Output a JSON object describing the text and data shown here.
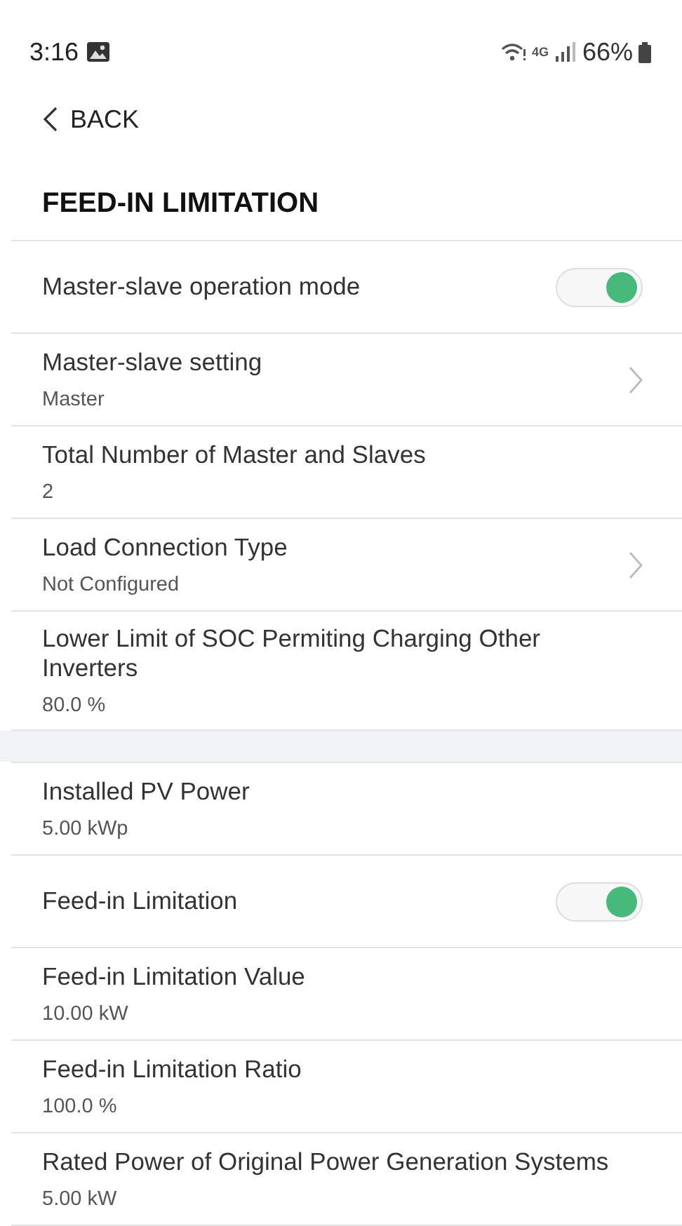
{
  "status_bar": {
    "time": "3:16",
    "network": "4G",
    "battery": "66%"
  },
  "back": {
    "label": "BACK"
  },
  "title": "FEED-IN LIMITATION",
  "sections": [
    {
      "items": [
        {
          "kind": "toggle",
          "label": "Master-slave operation mode",
          "on": true
        },
        {
          "kind": "nav",
          "label": "Master-slave setting",
          "value": "Master"
        },
        {
          "kind": "value",
          "label": "Total Number of Master and Slaves",
          "value": "2"
        },
        {
          "kind": "nav",
          "label": "Load Connection Type",
          "value": "Not Configured"
        },
        {
          "kind": "value",
          "label": "Lower Limit of SOC Permiting Charging Other Inverters",
          "value": "80.0 %"
        }
      ]
    },
    {
      "items": [
        {
          "kind": "value",
          "label": "Installed PV Power",
          "value": "5.00 kWp"
        },
        {
          "kind": "toggle",
          "label": "Feed-in Limitation",
          "on": true
        },
        {
          "kind": "value",
          "label": "Feed-in Limitation Value",
          "value": "10.00 kW"
        },
        {
          "kind": "value",
          "label": "Feed-in Limitation Ratio",
          "value": "100.0 %"
        },
        {
          "kind": "value",
          "label": "Rated Power of Original Power Generation Systems",
          "value": "5.00 kW"
        }
      ]
    }
  ]
}
